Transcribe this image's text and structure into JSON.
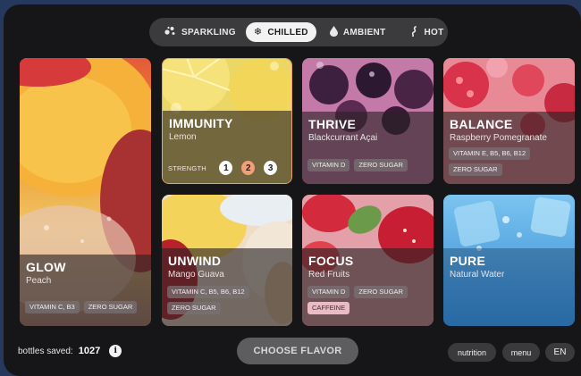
{
  "temperature": {
    "options": [
      {
        "label": "SPARKLING",
        "icon": "bubbles-icon",
        "active": false
      },
      {
        "label": "CHILLED",
        "icon": "snowflake-icon",
        "active": true
      },
      {
        "label": "AMBIENT",
        "icon": "droplet-icon",
        "active": false
      },
      {
        "label": "HOT",
        "icon": "steam-icon",
        "active": false
      }
    ]
  },
  "cards": {
    "glow": {
      "title": "GLOW",
      "subtitle": "Peach",
      "tags": [
        "VITAMIN C, B3",
        "ZERO SUGAR"
      ]
    },
    "immunity": {
      "title": "IMMUNITY",
      "subtitle": "Lemon",
      "strength_label": "STRENGTH",
      "strength_levels": [
        "1",
        "2",
        "3"
      ],
      "strength_selected": 2,
      "accent": "#e5a36e"
    },
    "thrive": {
      "title": "THRIVE",
      "subtitle": "Blackcurrant Açai",
      "tags": [
        "VITAMIN D",
        "ZERO SUGAR"
      ]
    },
    "balance": {
      "title": "BALANCE",
      "subtitle": "Raspberry Pomegranate",
      "tags": [
        "VITAMIN E, B5, B6, B12",
        "ZERO SUGAR"
      ]
    },
    "unwind": {
      "title": "UNWIND",
      "subtitle": "Mango Guava",
      "tags": [
        "VITAMIN C, B5, B6, B12",
        "ZERO SUGAR"
      ]
    },
    "focus": {
      "title": "FOCUS",
      "subtitle": "Red Fruits",
      "tags": [
        "VITAMIN D",
        "ZERO SUGAR"
      ],
      "highlight_tag": "CAFFEINE"
    },
    "pure": {
      "title": "PURE",
      "subtitle": "Natural Water"
    }
  },
  "footer": {
    "bottles_label": "bottles saved:",
    "bottles_count": "1027",
    "info_symbol": "i",
    "choose_label": "CHOOSE FLAVOR",
    "nutrition_label": "nutrition",
    "menu_label": "menu",
    "language_label": "EN"
  },
  "colors": {
    "frame": "#26395c",
    "screen": "#161618",
    "selected_strength": "#f0a07a",
    "caffeine_tag": "#e9bcc4"
  }
}
